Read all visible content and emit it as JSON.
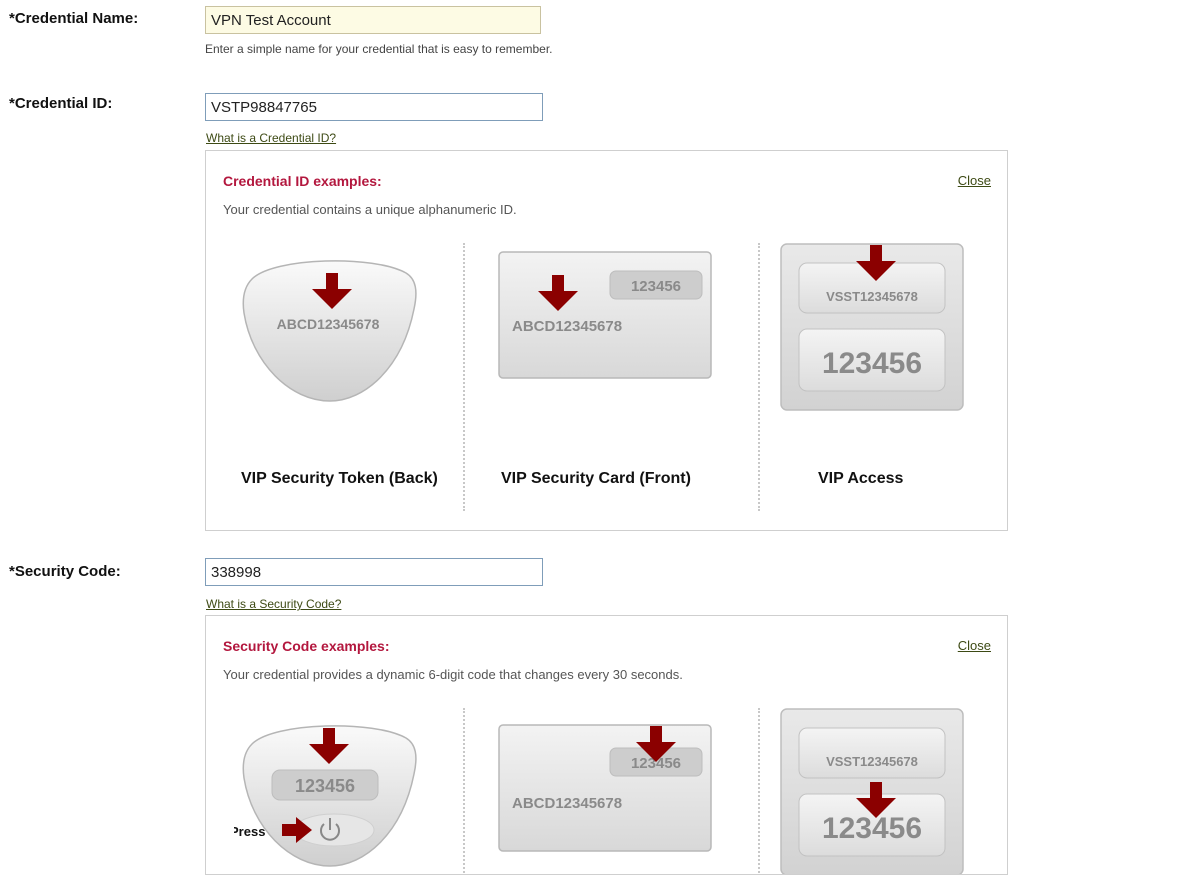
{
  "credential_name": {
    "label": "*Credential Name:",
    "value": "VPN Test Account",
    "hint": "Enter a simple name for your credential that is easy to remember."
  },
  "credential_id": {
    "label": "*Credential ID:",
    "value": "VSTP98847765",
    "help_link": "What is a Credential ID?",
    "examples": {
      "title": "Credential ID examples:",
      "close": "Close",
      "description": "Your credential contains a unique alphanumeric ID.",
      "devices": [
        {
          "caption": "VIP Security Token (Back)",
          "id_text": "ABCD12345678"
        },
        {
          "caption": "VIP Security Card (Front)",
          "code_text": "123456",
          "id_text": "ABCD12345678"
        },
        {
          "caption": "VIP Access",
          "id_text": "VSST12345678",
          "code_text": "123456"
        }
      ]
    }
  },
  "security_code": {
    "label": "*Security Code:",
    "value": "338998",
    "help_link": "What is a Security Code?",
    "examples": {
      "title": "Security Code examples:",
      "close": "Close",
      "description": "Your credential provides a dynamic 6-digit code that changes every 30 seconds.",
      "devices": [
        {
          "code_text": "123456",
          "press_label": "Press"
        },
        {
          "code_text": "123456",
          "id_text": "ABCD12345678"
        },
        {
          "id_text": "VSST12345678",
          "code_text": "123456"
        }
      ]
    }
  },
  "colors": {
    "accent_title": "#b3173e",
    "arrow": "#8b0000",
    "link": "#3d4a14"
  },
  "icons": [
    "down-arrow-icon",
    "right-arrow-icon",
    "power-icon"
  ]
}
